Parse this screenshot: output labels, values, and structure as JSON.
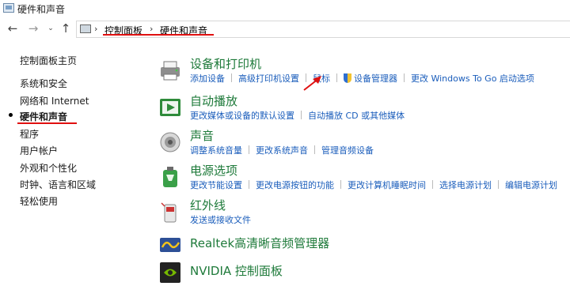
{
  "window": {
    "title": "硬件和声音"
  },
  "address_bar": {
    "crumbs": [
      "控制面板",
      "硬件和声音"
    ]
  },
  "left_nav": {
    "items": [
      "控制面板主页",
      "系统和安全",
      "网络和 Internet",
      "硬件和声音",
      "程序",
      "用户帐户",
      "外观和个性化",
      "时钟、语言和区域",
      "轻松使用"
    ],
    "current": "硬件和声音"
  },
  "sections": [
    {
      "title": "设备和打印机",
      "icon": "printer-icon",
      "links": [
        "添加设备",
        "高级打印机设置",
        "鼠标",
        "设备管理器",
        "更改 Windows To Go 启动选项"
      ]
    },
    {
      "title": "自动播放",
      "icon": "autoplay-icon",
      "links": [
        "更改媒体或设备的默认设置",
        "自动播放 CD 或其他媒体"
      ]
    },
    {
      "title": "声音",
      "icon": "speaker-icon",
      "links": [
        "调整系统音量",
        "更改系统声音",
        "管理音频设备"
      ]
    },
    {
      "title": "电源选项",
      "icon": "power-icon",
      "links": [
        "更改节能设置",
        "更改电源按钮的功能",
        "更改计算机睡眠时间",
        "选择电源计划",
        "编辑电源计划"
      ]
    },
    {
      "title": "红外线",
      "icon": "infrared-icon",
      "links": [
        "发送或接收文件"
      ]
    },
    {
      "title": "Realtek高清晰音频管理器",
      "icon": "realtek-icon",
      "links": []
    },
    {
      "title": "NVIDIA 控制面板",
      "icon": "nvidia-icon",
      "links": []
    }
  ],
  "colors": {
    "accent_green": "#1e7a3a",
    "link_blue": "#1a5dbb",
    "annotation_red": "#e01010"
  }
}
